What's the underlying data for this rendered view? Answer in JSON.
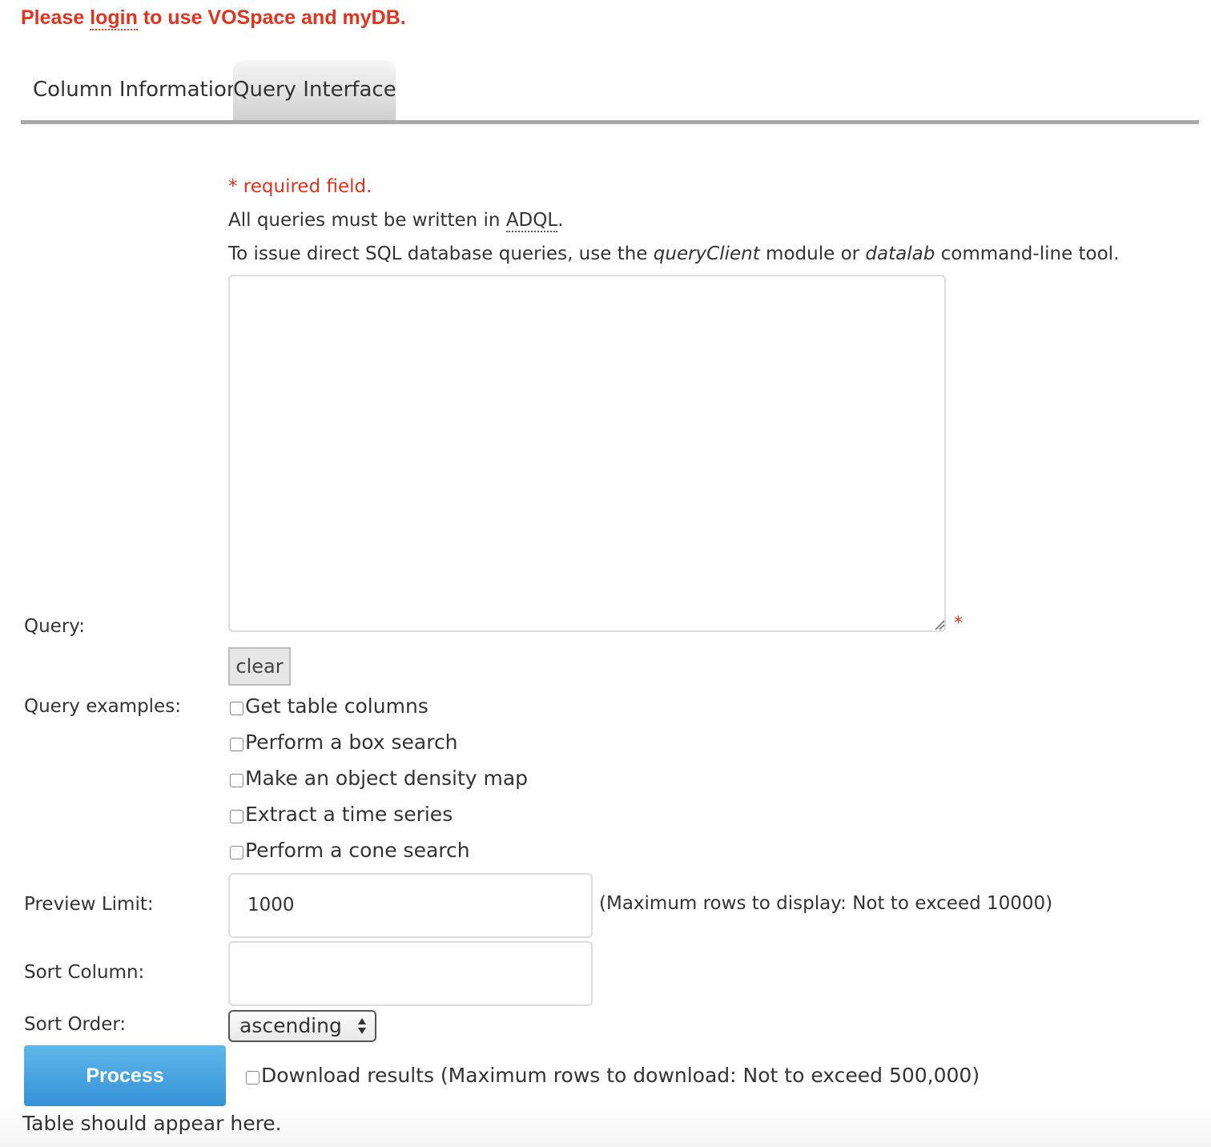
{
  "banner": {
    "prefix": "Please ",
    "link": "login",
    "suffix": " to use VOSpace and myDB."
  },
  "tabs": [
    {
      "label": "Column Information",
      "active": false
    },
    {
      "label": "Query Interface",
      "active": true
    }
  ],
  "form": {
    "required_note": "* required field.",
    "adql_line": {
      "prefix": "All queries must be written in ",
      "abbr": "ADQL",
      "suffix": "."
    },
    "sql_line": {
      "prefix": "To issue direct SQL database queries, use the ",
      "module": "queryClient",
      "middle": " module or ",
      "tool": "datalab",
      "suffix": " command-line tool."
    },
    "query_label": "Query:",
    "query_value": "",
    "required_star": "*",
    "clear_label": "clear",
    "examples_label": "Query examples:",
    "examples": [
      "Get table columns",
      "Perform a box search",
      "Make an object density map",
      "Extract a time series",
      "Perform a cone search"
    ],
    "preview_label": "Preview Limit:",
    "preview_value": "1000",
    "preview_hint": "(Maximum rows to display: Not to exceed 10000)",
    "sort_column_label": "Sort Column:",
    "sort_column_value": "",
    "sort_order_label": "Sort Order:",
    "sort_order_value": "ascending",
    "process_label": "Process",
    "download_label": "Download results (Maximum rows to download: Not to exceed 500,000)",
    "table_message": "Table should appear here."
  },
  "colors": {
    "alert_red": "#e1331f",
    "button_blue": "#3592d6",
    "tab_border": "#a8a8a8"
  },
  "icons": {
    "resize": "resize-grip-icon",
    "select": "chevron-updown-icon",
    "checkbox": "checkbox-unchecked-icon"
  }
}
